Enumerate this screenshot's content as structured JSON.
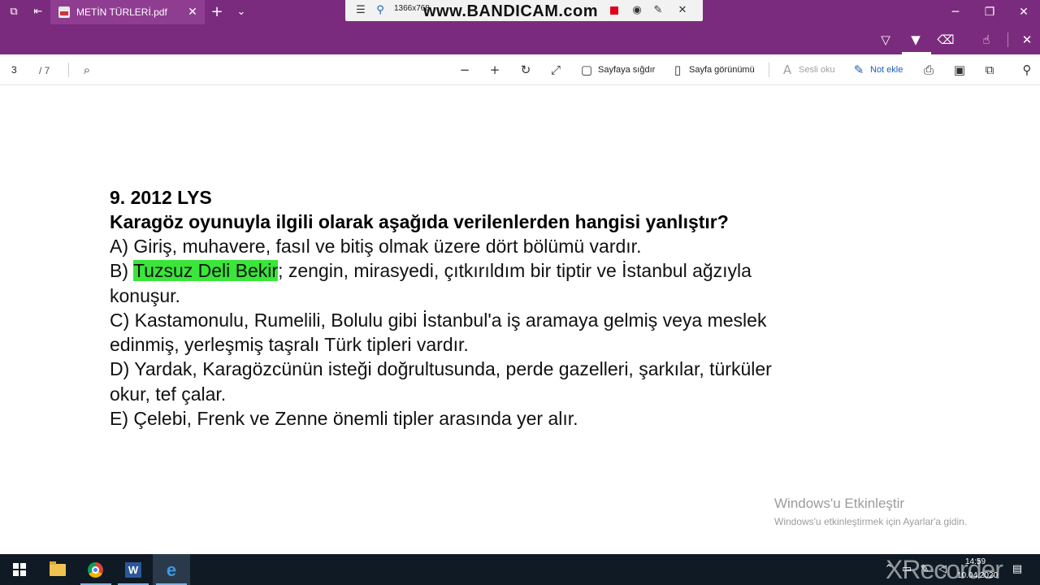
{
  "titlebar": {
    "tab_title": "METİN TÜRLERİ.pdf",
    "icons": [
      "tab-set-aside-icon",
      "back-tabs-icon",
      "pdf-file-icon",
      "close-icon",
      "new-tab-icon",
      "chevron-down-icon"
    ],
    "window_controls": [
      "minimize-icon",
      "restore-icon",
      "close-icon"
    ]
  },
  "bandicam": {
    "resolution": "1366x768",
    "watermark": "www.BANDICAM.com",
    "rec_color": "#e0001a"
  },
  "pdf_toolbar": {
    "page_number": "3",
    "page_total": "/ 7",
    "fit_page_label": "Sayfaya sığdır",
    "page_view_label": "Sayfa görünümü",
    "read_aloud_label": "Sesli oku",
    "add_note_label": "Not ekle"
  },
  "document": {
    "question_number": "9.  2012 LYS",
    "question_text": "Karagöz oyunuyla ilgili olarak aşağıda verilenlerden hangisi yanlıştır?",
    "option_a": "A) Giriş, muhavere, fasıl ve bitiş olmak üzere dört bölümü vardır.",
    "option_b_prefix": "B) ",
    "option_b_highlight": "Tuzsuz Deli Bekir",
    "option_b_rest": "; zengin, mirasyedi, çıtkırıldım bir tiptir ve İstanbul ağzıyla",
    "option_b_cont": "konuşur.",
    "option_c_line1": "C) Kastamonulu, Rumelili, Bolulu gibi İstanbul'a iş aramaya gelmiş veya meslek",
    "option_c_line2": "edinmiş, yerleşmiş taşralı Türk tipleri vardır.",
    "option_d_line1": "D) Yardak, Karagözcünün isteği doğrultusunda, perde gazelleri, şarkılar, türküler",
    "option_d_line2": "okur, tef çalar.",
    "option_e": "E) Çelebi, Frenk ve Zenne önemli tipler arasında yer alır.",
    "highlight_color": "#39e639"
  },
  "activation": {
    "title": "Windows'u Etkinleştir",
    "subtitle": "Windows'u etkinleştirmek için Ayarlar'a gidin."
  },
  "taskbar": {
    "time": "14:59",
    "date": "10.04.2020",
    "watermark": "XRecorder",
    "apps": [
      "start",
      "file-explorer",
      "chrome",
      "word",
      "edge"
    ]
  },
  "colors": {
    "titlebar": "#7b2b7d",
    "taskbar": "#0f1a24"
  }
}
